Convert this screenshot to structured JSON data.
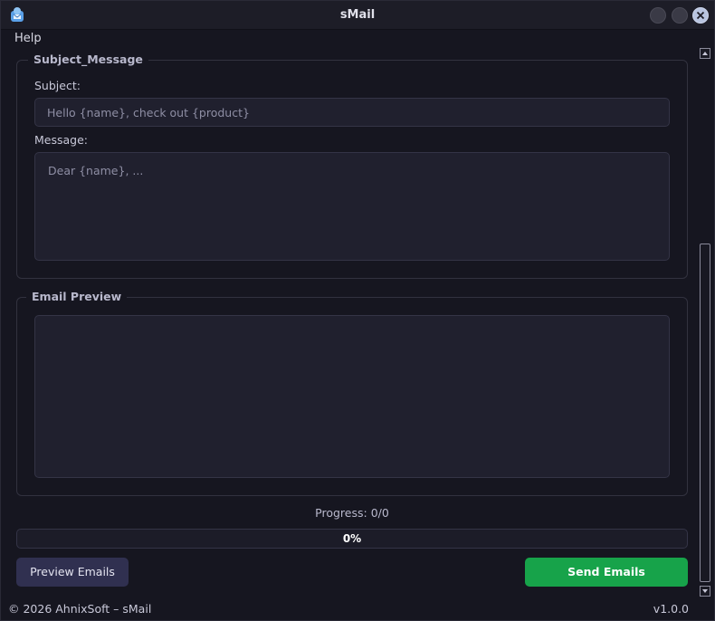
{
  "window": {
    "title": "sMail"
  },
  "menu": {
    "help": "Help"
  },
  "subject_message": {
    "group_title": "Subject_Message",
    "subject_label": "Subject:",
    "subject_placeholder": "Hello {name}, check out {product}",
    "message_label": "Message:",
    "message_placeholder": "Dear {name}, ..."
  },
  "preview": {
    "group_title": "Email Preview",
    "content": ""
  },
  "progress": {
    "text": "Progress: 0/0",
    "percent_label": "0%",
    "fraction": 0
  },
  "buttons": {
    "preview_label": "Preview Emails",
    "send_label": "Send Emails"
  },
  "footer": {
    "copyright": "© 2026 AhnixSoft – sMail",
    "version": "v1.0.0"
  },
  "colors": {
    "background": "#161620",
    "accent_green": "#17a34a",
    "button_secondary": "#303050",
    "field_bg": "#20202e"
  }
}
